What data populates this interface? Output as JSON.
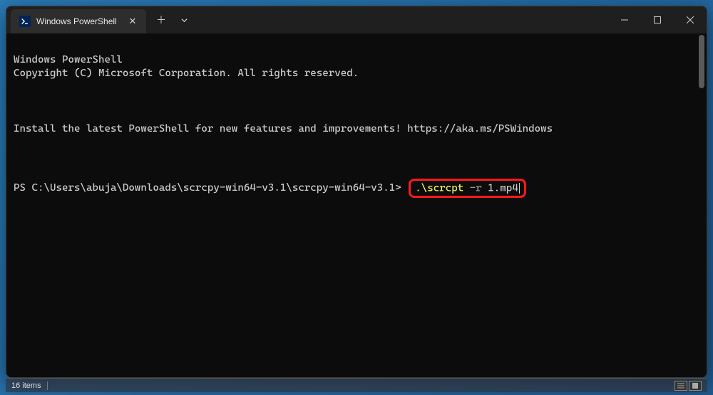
{
  "window": {
    "tab_title": "Windows PowerShell",
    "tab_icon_glyph": ">_"
  },
  "terminal": {
    "header1": "Windows PowerShell",
    "header2": "Copyright (C) Microsoft Corporation. All rights reserved.",
    "install_msg": "Install the latest PowerShell for new features and improvements! https://aka.ms/PSWindows",
    "prompt": "PS C:\\Users\\abuja\\Downloads\\scrcpy-win64-v3.1\\scrcpy-win64-v3.1>",
    "command_exe": ".\\scrcpt",
    "command_flag": "-r",
    "command_arg": "1.mp4"
  },
  "statusbar": {
    "items_text": "16 items"
  },
  "highlight": {
    "border_color": "#ff1a1a"
  }
}
